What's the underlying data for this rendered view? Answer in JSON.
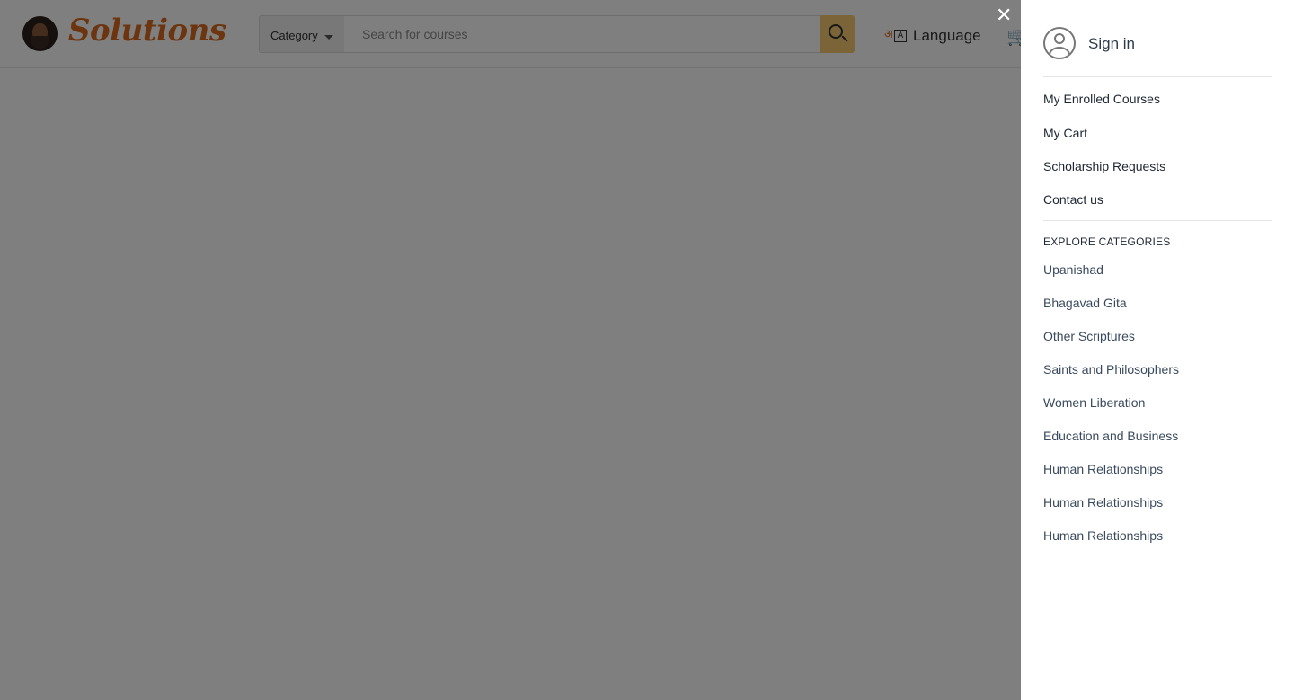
{
  "header": {
    "brand": "Solutions",
    "category_label": "Category",
    "search_placeholder": "Search for courses",
    "language_label": "Language",
    "language_glyph": "अ",
    "language_glyph2": "A"
  },
  "drawer": {
    "sign_in": "Sign in",
    "menu": [
      "My Enrolled Courses",
      "My Cart",
      "Scholarship Requests",
      "Contact us"
    ],
    "categories_title": "EXPLORE CATEGORIES",
    "categories": [
      "Upanishad",
      "Bhagavad Gita",
      "Other Scriptures",
      "Saints and Philosophers",
      "Women Liberation",
      "Education and Business",
      "Human Relationships",
      "Human Relationships",
      "Human Relationships"
    ]
  },
  "icons": {
    "close": "close-icon",
    "search": "search-icon",
    "cart": "cart-icon",
    "language": "language-icon",
    "user": "user-icon"
  },
  "colors": {
    "brand": "#d96a1e",
    "search_button": "#f7c871",
    "overlay": "rgba(0,0,0,0.5)"
  }
}
